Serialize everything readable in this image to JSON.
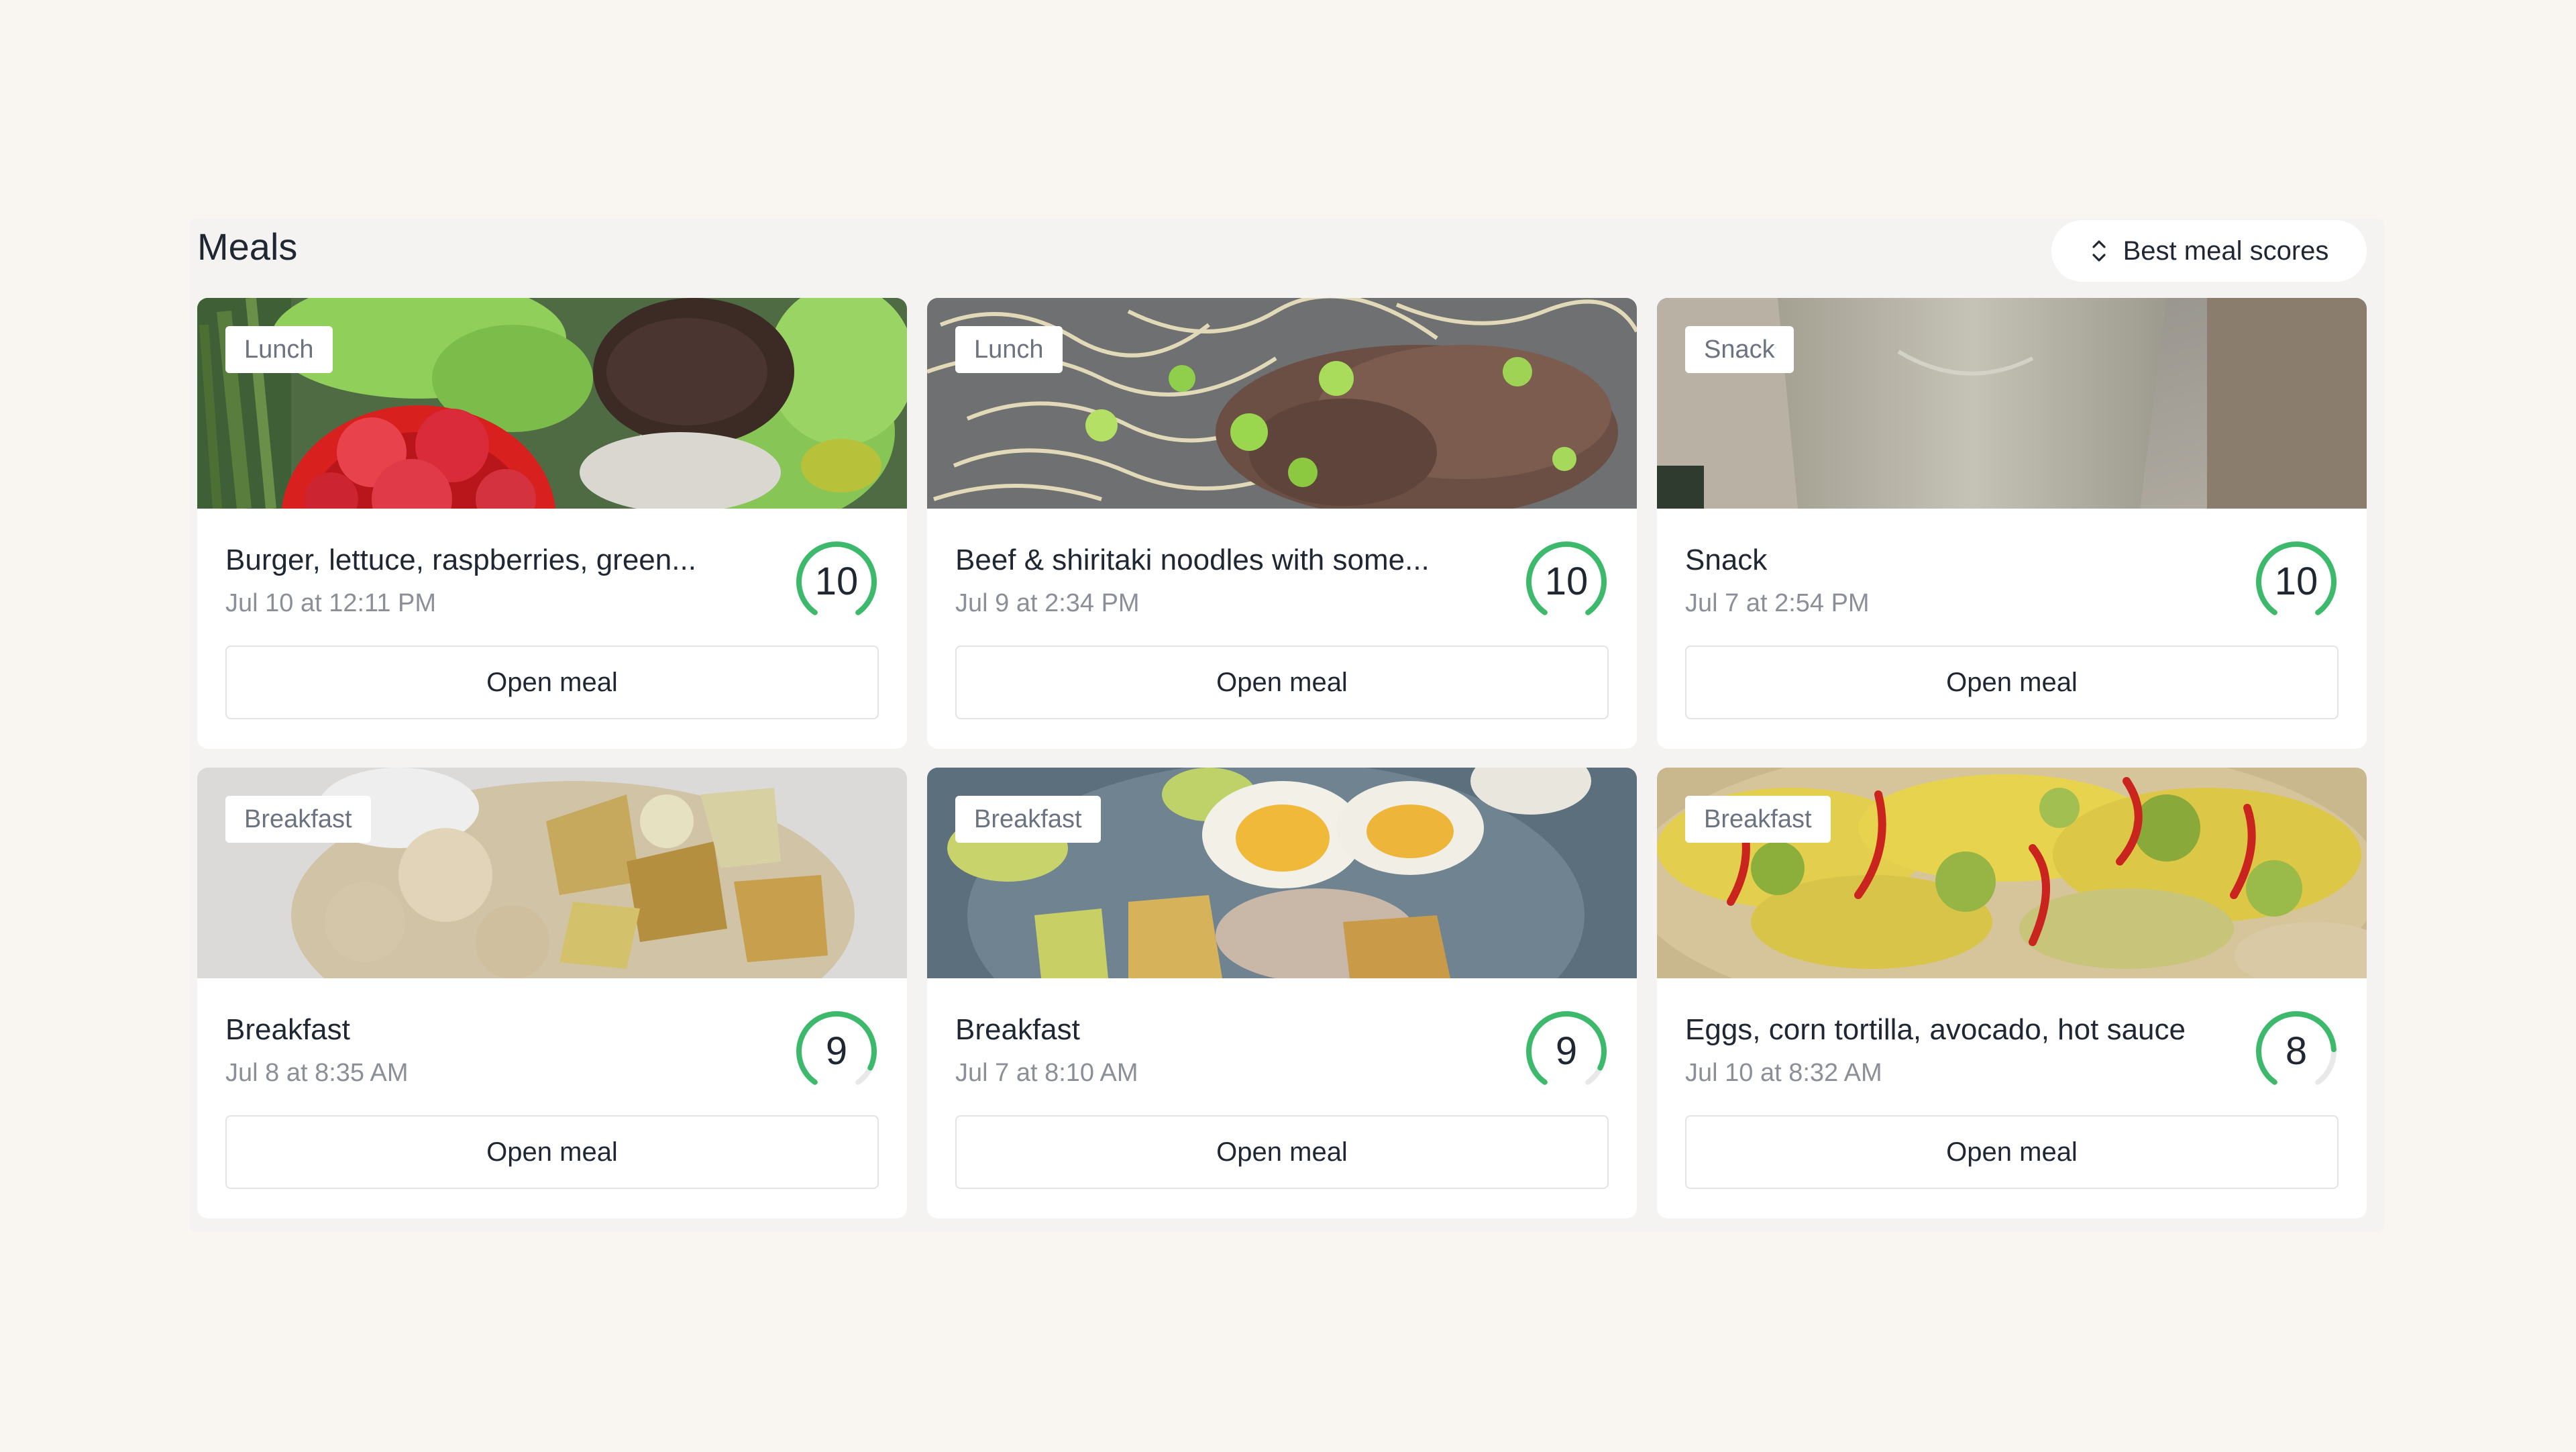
{
  "section": {
    "title": "Meals",
    "sort_label": "Best meal scores"
  },
  "colors": {
    "score_ring": "#3cb96b",
    "score_track": "#e8e8e8"
  },
  "meals": [
    {
      "tag": "Lunch",
      "name": "Burger, lettuce, raspberries, green...",
      "time": "Jul 10 at 12:11 PM",
      "score": "10",
      "score_fraction": 1.0,
      "image_icon": "burger-salad-photo",
      "open_label": "Open meal"
    },
    {
      "tag": "Lunch",
      "name": "Beef & shiritaki noodles with some...",
      "time": "Jul 9 at 2:34 PM",
      "score": "10",
      "score_fraction": 1.0,
      "image_icon": "beef-noodles-photo",
      "open_label": "Open meal"
    },
    {
      "tag": "Snack",
      "name": "Snack",
      "time": "Jul 7 at 2:54 PM",
      "score": "10",
      "score_fraction": 1.0,
      "image_icon": "smoothie-photo",
      "open_label": "Open meal"
    },
    {
      "tag": "Breakfast",
      "name": "Breakfast",
      "time": "Jul 8 at 8:35 AM",
      "score": "9",
      "score_fraction": 0.9,
      "image_icon": "breakfast-bowl-photo",
      "open_label": "Open meal"
    },
    {
      "tag": "Breakfast",
      "name": "Breakfast",
      "time": "Jul 7 at 8:10 AM",
      "score": "9",
      "score_fraction": 0.9,
      "image_icon": "eggs-plate-photo",
      "open_label": "Open meal"
    },
    {
      "tag": "Breakfast",
      "name": "Eggs, corn tortilla, avocado, hot sauce",
      "time": "Jul 10 at 8:32 AM",
      "score": "8",
      "score_fraction": 0.8,
      "image_icon": "egg-tortilla-photo",
      "open_label": "Open meal"
    }
  ]
}
